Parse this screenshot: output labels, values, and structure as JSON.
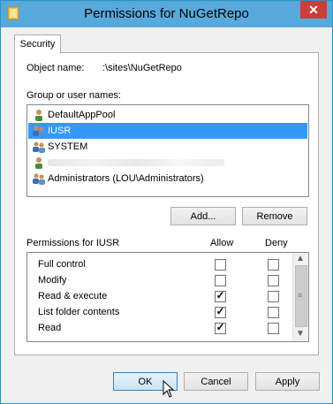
{
  "window": {
    "title": "Permissions for NuGetRepo",
    "close_glyph": "✕"
  },
  "tabs": [
    {
      "label": "Security"
    }
  ],
  "object": {
    "label": "Object name:",
    "value": ":\\sites\\NuGetRepo"
  },
  "groups": {
    "label": "Group or user names:",
    "items": [
      {
        "label": "DefaultAppPool",
        "icon": "user-icon",
        "selected": false
      },
      {
        "label": "IUSR",
        "icon": "users-group-icon",
        "selected": true
      },
      {
        "label": "SYSTEM",
        "icon": "users-group-icon",
        "selected": false
      },
      {
        "label": "",
        "icon": "user-icon",
        "selected": false
      },
      {
        "label": "Administrators (LOU\\Administrators)",
        "icon": "users-group-icon",
        "selected": false
      }
    ]
  },
  "buttons": {
    "add": "Add...",
    "remove": "Remove"
  },
  "permissions": {
    "label": "Permissions for IUSR",
    "allow_label": "Allow",
    "deny_label": "Deny",
    "rows": [
      {
        "name": "Full control",
        "allow": false,
        "deny": false
      },
      {
        "name": "Modify",
        "allow": false,
        "deny": false
      },
      {
        "name": "Read & execute",
        "allow": true,
        "deny": false
      },
      {
        "name": "List folder contents",
        "allow": true,
        "deny": false
      },
      {
        "name": "Read",
        "allow": true,
        "deny": false
      }
    ]
  },
  "footer": {
    "ok": "OK",
    "cancel": "Cancel",
    "apply": "Apply"
  },
  "colors": {
    "title_bar": "#57a9dc",
    "selection": "#3399ff",
    "close": "#c7413a"
  }
}
